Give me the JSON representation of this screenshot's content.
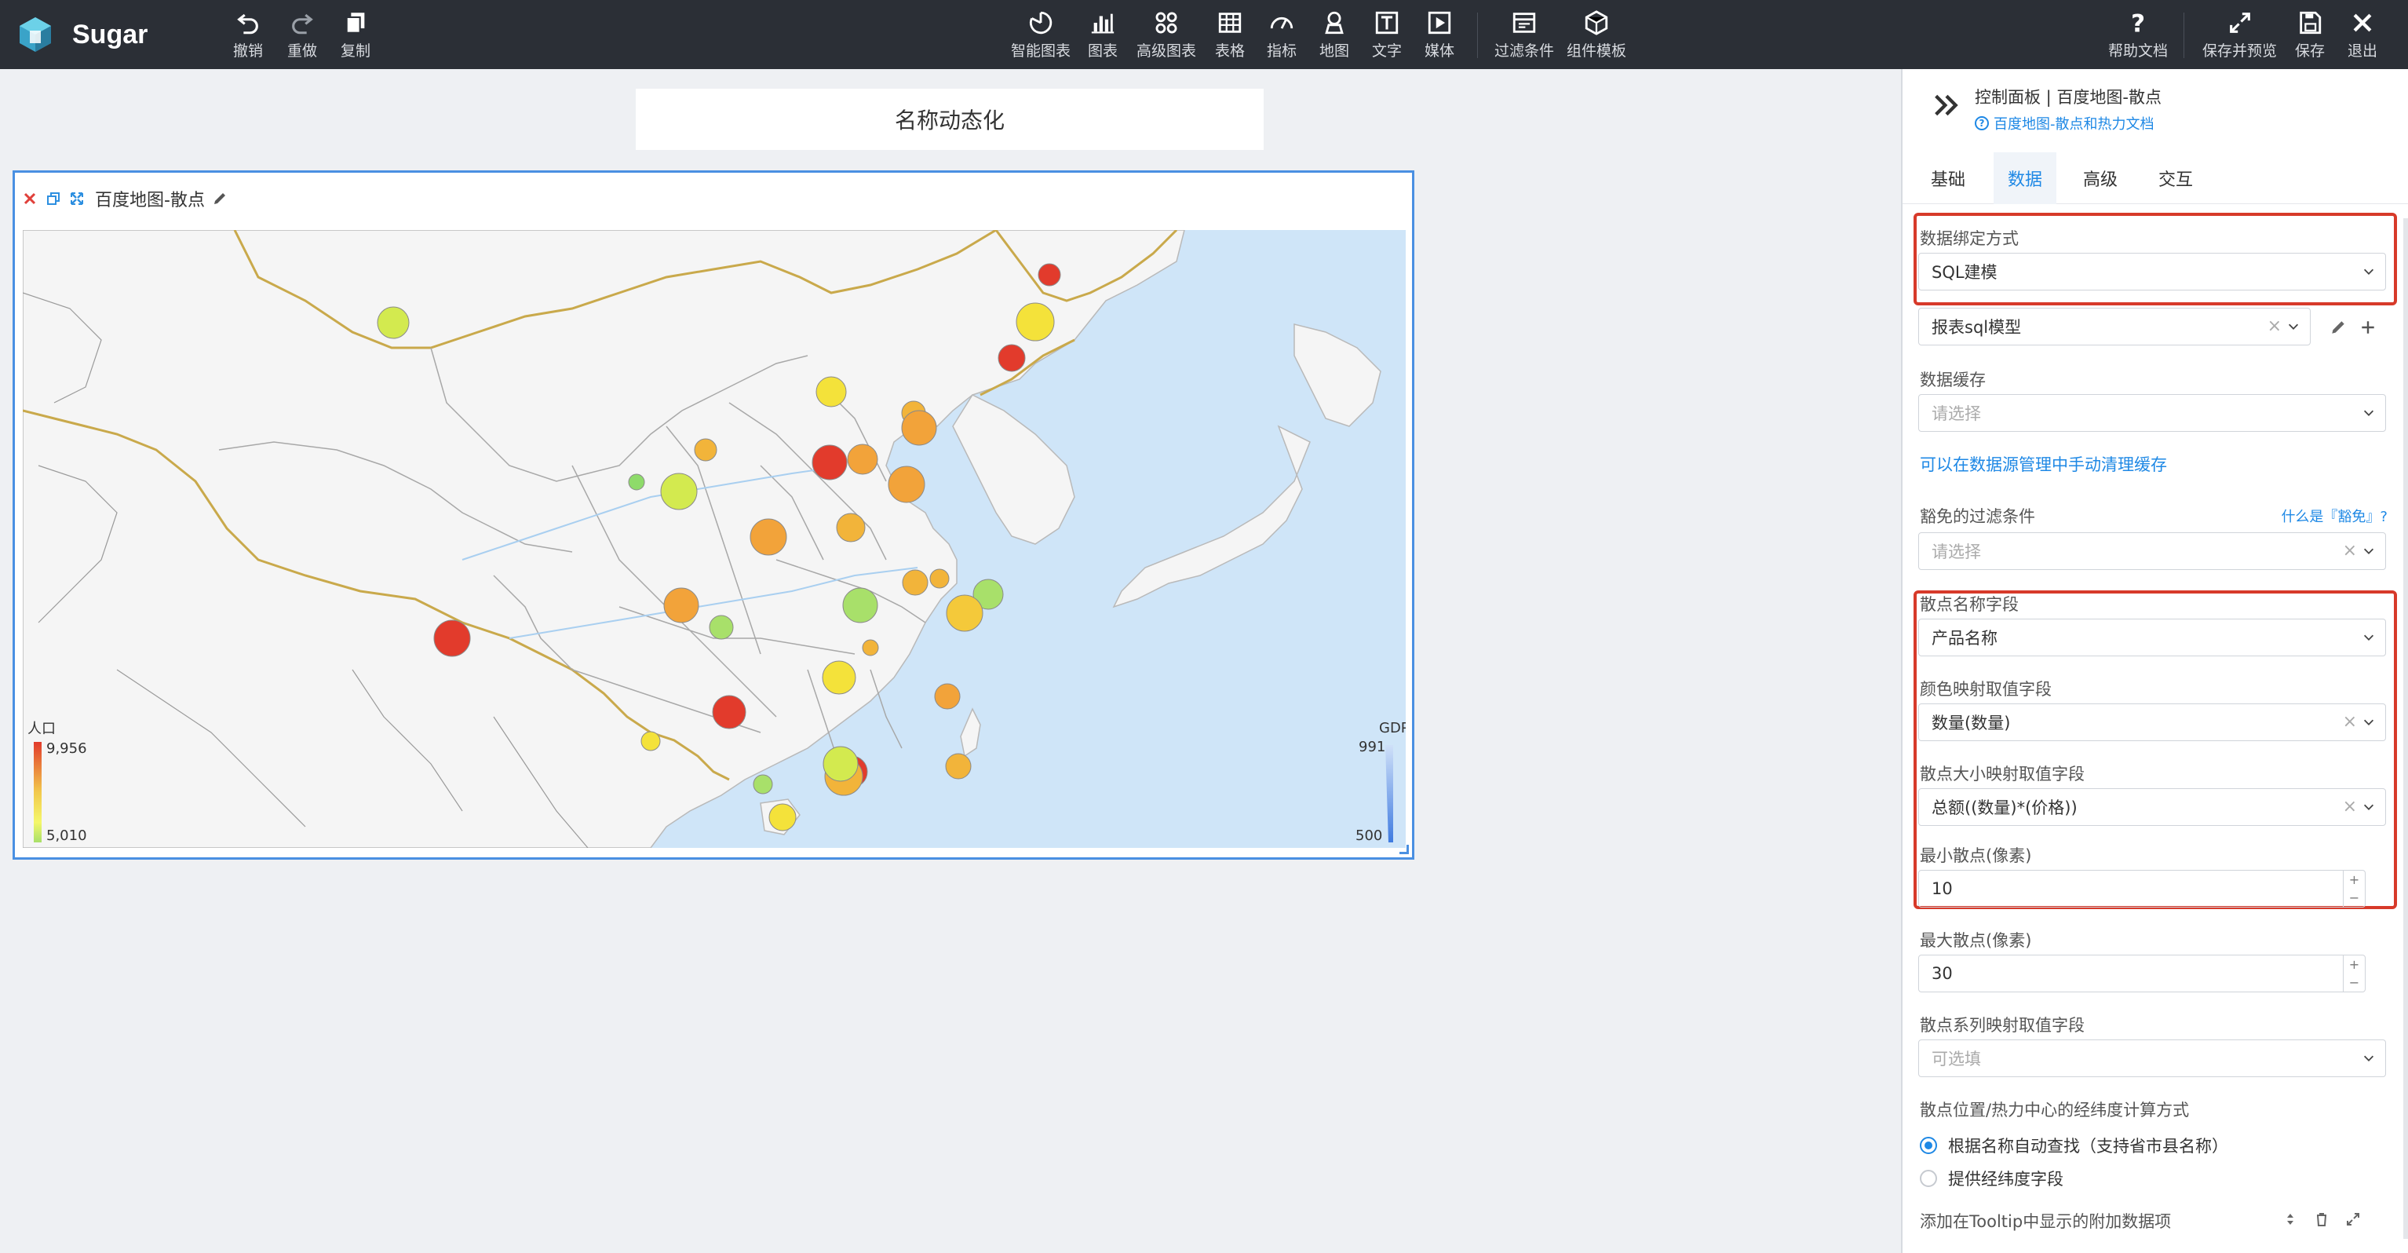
{
  "app": {
    "name": "Sugar"
  },
  "toolbar": {
    "left": [
      {
        "label": "撤销",
        "icon": "undo-icon"
      },
      {
        "label": "重做",
        "icon": "redo-icon"
      },
      {
        "label": "复制",
        "icon": "copy-icon"
      }
    ],
    "center": [
      {
        "label": "智能图表",
        "icon": "smart-chart-icon"
      },
      {
        "label": "图表",
        "icon": "chart-icon"
      },
      {
        "label": "高级图表",
        "icon": "advanced-chart-icon"
      },
      {
        "label": "表格",
        "icon": "table-icon"
      },
      {
        "label": "指标",
        "icon": "gauge-icon"
      },
      {
        "label": "地图",
        "icon": "map-pin-icon"
      },
      {
        "label": "文字",
        "icon": "text-icon"
      },
      {
        "label": "媒体",
        "icon": "media-icon"
      },
      {
        "label": "过滤条件",
        "icon": "filter-icon"
      },
      {
        "label": "组件模板",
        "icon": "template-icon"
      }
    ],
    "right": [
      {
        "label": "帮助文档",
        "icon": "help-icon"
      },
      {
        "label": "保存并预览",
        "icon": "expand-icon"
      },
      {
        "label": "保存",
        "icon": "save-icon"
      },
      {
        "label": "退出",
        "icon": "close-icon"
      }
    ]
  },
  "canvas": {
    "title": "名称动态化",
    "widget": {
      "title": "百度地图-散点",
      "legend_left": {
        "title": "人口",
        "max": "9,956",
        "min": "5,010"
      },
      "legend_right": {
        "title": "GDP",
        "max": "991",
        "min": "500"
      }
    }
  },
  "panel": {
    "breadcrumb": "控制面板 | 百度地图-散点",
    "doc_link": "百度地图-散点和热力文档",
    "tabs": [
      "基础",
      "数据",
      "高级",
      "交互"
    ],
    "active_tab": "数据",
    "fields": {
      "binding_label": "数据绑定方式",
      "binding_value": "SQL建模",
      "model_value": "报表sql模型",
      "cache_label": "数据缓存",
      "cache_placeholder": "请选择",
      "cache_link": "可以在数据源管理中手动清理缓存",
      "exempt_label": "豁免的过滤条件",
      "exempt_help": "什么是『豁免』?",
      "exempt_placeholder": "请选择",
      "name_field_label": "散点名称字段",
      "name_field_value": "产品名称",
      "color_field_label": "颜色映射取值字段",
      "color_field_value": "数量(数量)",
      "size_field_label": "散点大小映射取值字段",
      "size_field_value": "总额((数量)*(价格))",
      "min_size_label": "最小散点(像素)",
      "min_size_value": "10",
      "max_size_label": "最大散点(像素)",
      "max_size_value": "30",
      "series_label": "散点系列映射取值字段",
      "series_placeholder": "可选填",
      "geo_label": "散点位置/热力中心的经纬度计算方式",
      "geo_option1": "根据名称自动查找（支持省市县名称）",
      "geo_option2": "提供经纬度字段",
      "tooltip_label": "添加在Tooltip中显示的附加数据项"
    }
  },
  "colors": {
    "accent": "#1e88e5",
    "topbar": "#2b2f36",
    "highlight": "#d73a2a",
    "sea": "#cfe5f8"
  }
}
